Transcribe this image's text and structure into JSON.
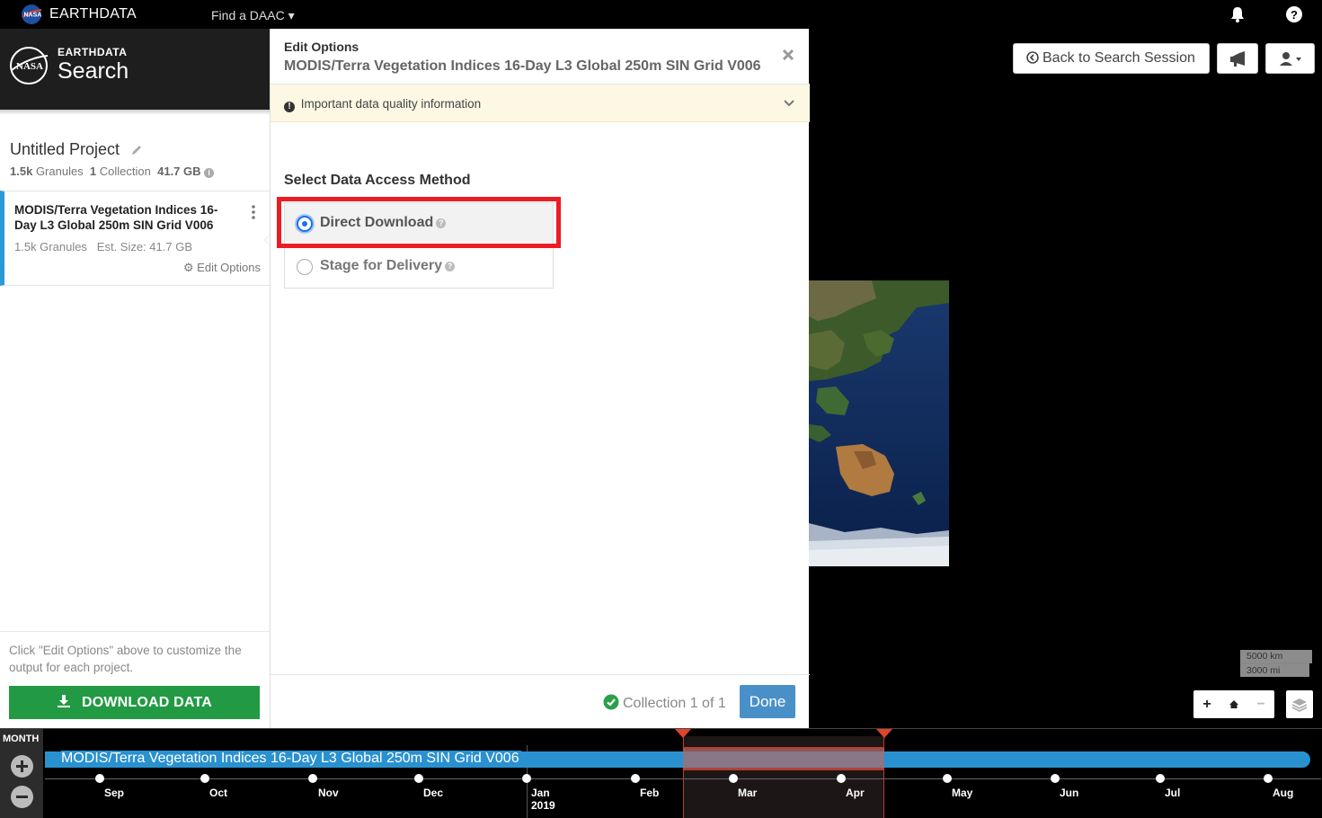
{
  "topbar": {
    "brand": "EARTHDATA",
    "find_daac": "Find a DAAC ▾"
  },
  "sidebar": {
    "app_small": "EARTHDATA",
    "app_big": "Search",
    "project_name": "Untitled Project",
    "stats": {
      "granules_value": "1.5k",
      "granules_label": "Granules",
      "collections_value": "1",
      "collections_label": "Collection",
      "size": "41.7 GB"
    },
    "collection": {
      "title": "MODIS/Terra Vegetation Indices 16-Day L3 Global 250m SIN Grid V006",
      "granules": "1.5k Granules",
      "est_size": "Est. Size: 41.7 GB",
      "edit_options": "Edit Options"
    },
    "help_text": "Click \"Edit Options\" above to customize the output for each project.",
    "download_label": "DOWNLOAD DATA"
  },
  "panel": {
    "subtitle": "Edit Options",
    "title": "MODIS/Terra Vegetation Indices 16-Day L3 Global 250m SIN Grid V006",
    "notice": "Important data quality information",
    "select_title": "Select Data Access Method",
    "options": [
      {
        "label": "Direct Download",
        "selected": true
      },
      {
        "label": "Stage for Delivery",
        "selected": false
      }
    ],
    "collection_count": "Collection 1 of 1",
    "done_label": "Done",
    "highlight_color": "#ec1c24"
  },
  "map": {
    "back_label": "Back to Search Session",
    "scale_km": "5000 km",
    "scale_mi": "3000 mi"
  },
  "timeline": {
    "unit": "MONTH",
    "bar_label": "MODIS/Terra Vegetation Indices 16-Day L3 Global 250m SIN Grid V006",
    "months": [
      "Sep",
      "Oct",
      "Nov",
      "Dec",
      "Jan",
      "Feb",
      "Mar",
      "Apr",
      "May",
      "Jun",
      "Jul",
      "Aug"
    ],
    "year": "2019",
    "accent": "#2a91d0"
  }
}
